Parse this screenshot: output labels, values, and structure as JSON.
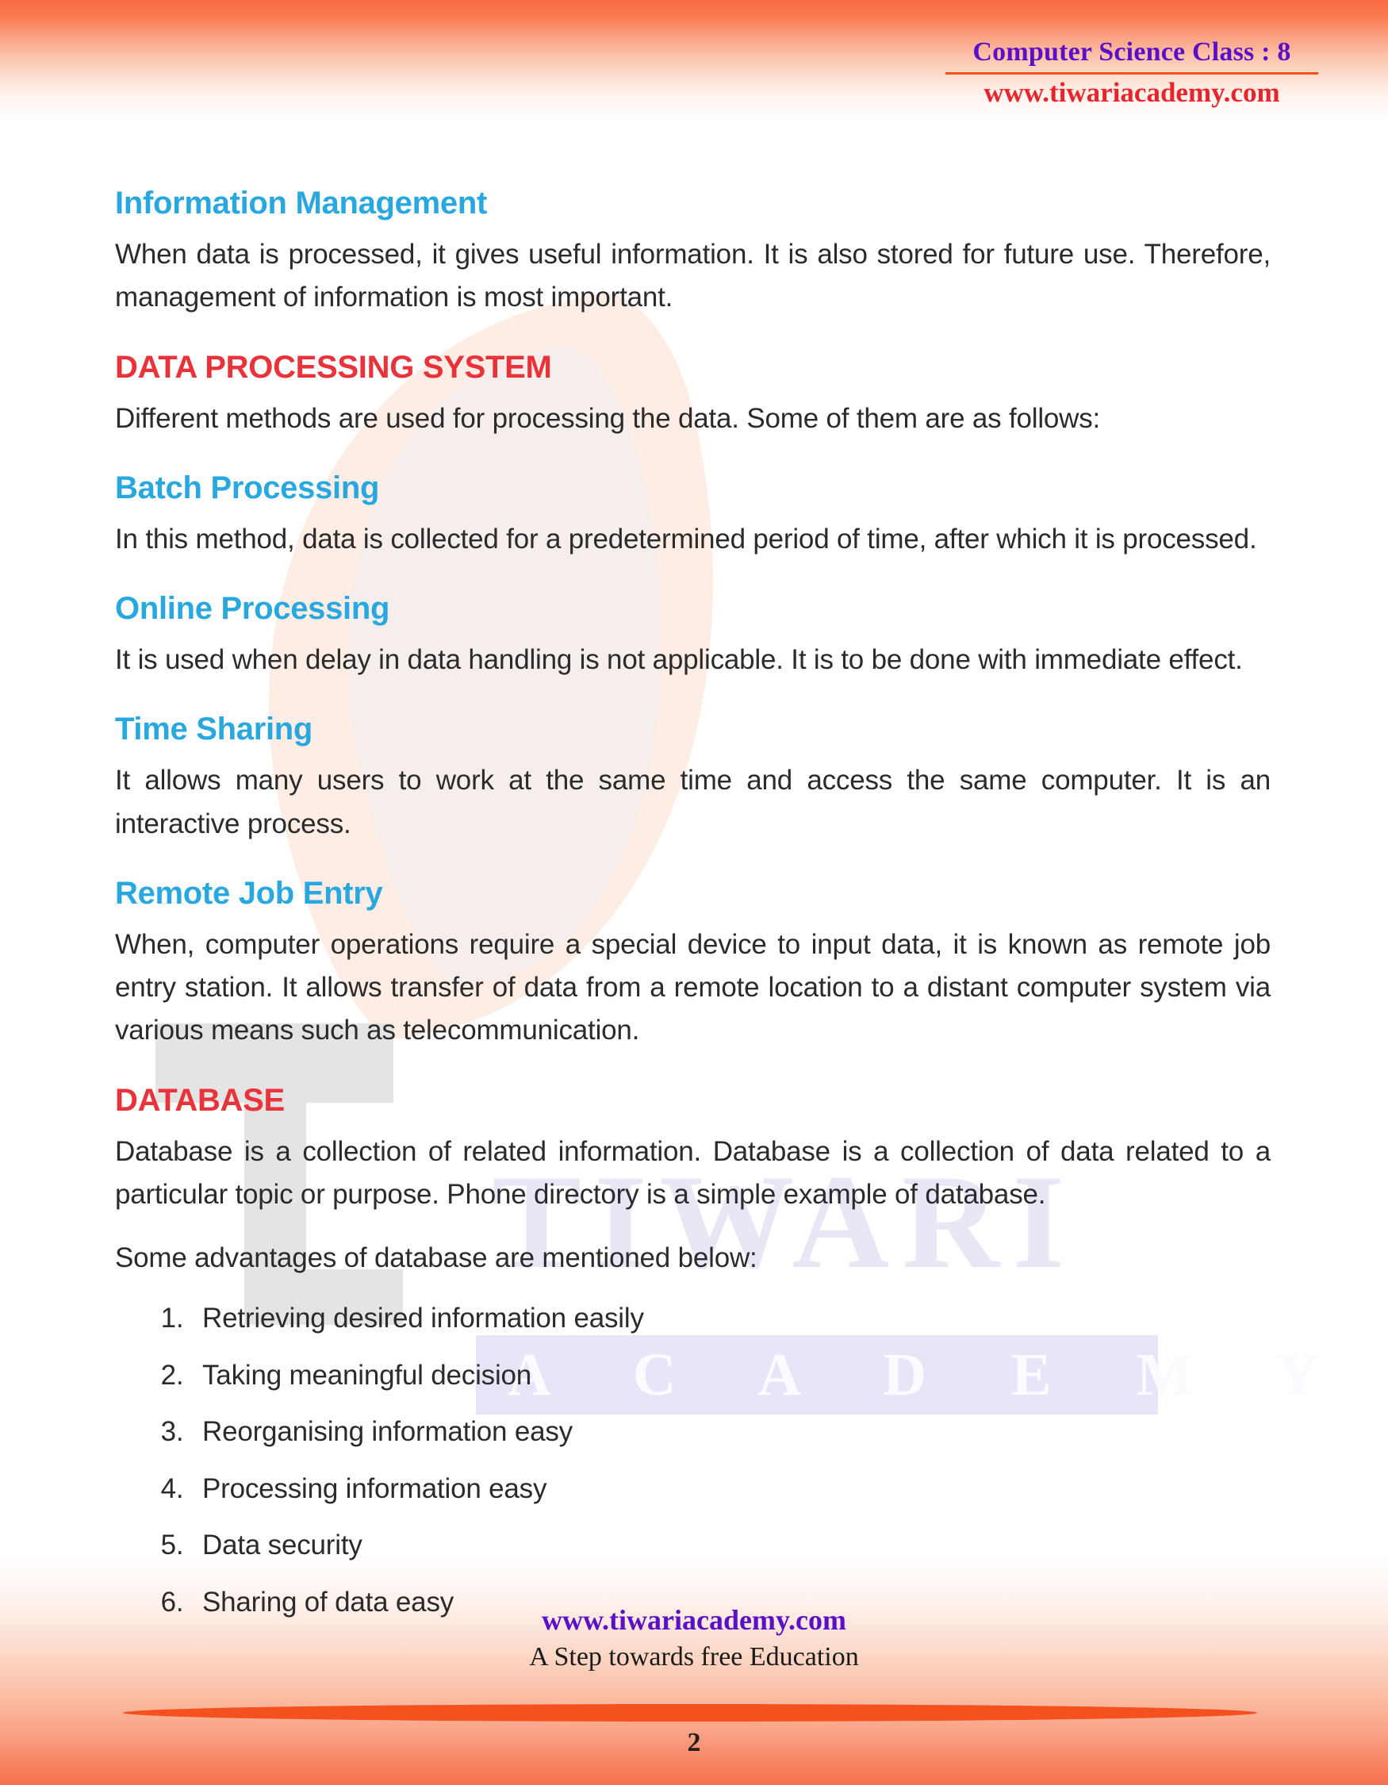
{
  "header": {
    "title": "Computer Science Class : 8",
    "site": "www.tiwariacademy.com"
  },
  "watermark": {
    "brand_primary": "TIWARI",
    "brand_secondary": "A C A D E M Y",
    "leaf_color": "#fdeadf",
    "letter_color": "#e3e3e3",
    "band_color": "#e9e5f8"
  },
  "colors": {
    "heading_blue": "#29a8e0",
    "heading_red": "#e8333a",
    "accent_orange": "#f4511e",
    "header_purple": "#5b10c8",
    "header_red": "#e8252b",
    "body_text": "#2b2b2b"
  },
  "sections": [
    {
      "heading": "Information Management",
      "heading_style": "blue",
      "body": "When data is processed, it gives useful information. It is also stored for future use. Therefore, management of information is most important."
    },
    {
      "heading": "DATA PROCESSING SYSTEM",
      "heading_style": "red",
      "body": "Different methods are used for processing the data. Some of them are as follows:"
    },
    {
      "heading": "Batch Processing",
      "heading_style": "blue",
      "body": "In this method, data is collected for a predetermined period of time, after which it is processed."
    },
    {
      "heading": "Online Processing",
      "heading_style": "blue",
      "body": "It is used when delay in data handling is not applicable. It is to be done with immediate effect."
    },
    {
      "heading": "Time Sharing",
      "heading_style": "blue",
      "body": "It allows many users to work at the same time and access the same computer. It is an interactive process."
    },
    {
      "heading": "Remote Job Entry",
      "heading_style": "blue",
      "body": "When, computer operations require a special device to input data, it is known as remote job entry station. It allows transfer of data from a remote location to a distant computer system via various means such as telecommunication."
    },
    {
      "heading": "DATABASE",
      "heading_style": "red",
      "body": "Database is a collection of related information. Database is a collection of data related to a particular topic or purpose. Phone directory is a simple example of database.",
      "body2": "Some advantages of database are mentioned below:"
    }
  ],
  "advantages": [
    "Retrieving desired information easily",
    "Taking meaningful decision",
    "Reorganising information easy",
    "Processing information easy",
    "Data security",
    "Sharing of data easy"
  ],
  "footer": {
    "site": "www.tiwariacademy.com",
    "tagline": "A Step towards free Education",
    "page_number": "2"
  }
}
